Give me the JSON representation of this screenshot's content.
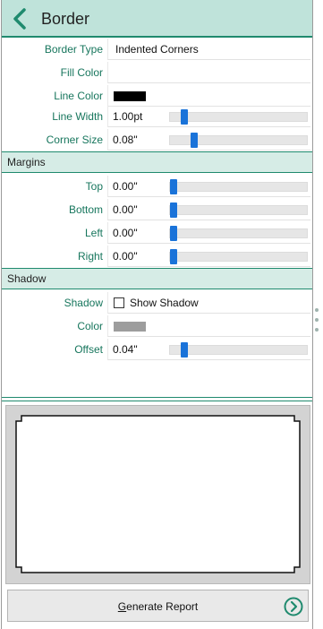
{
  "header": {
    "title": "Border",
    "back_icon": "chevron-left-icon"
  },
  "colors": {
    "accent": "#1f8a6e",
    "header_bg": "#bfe3da",
    "section_bg": "#d6ece6",
    "label": "#17765d",
    "slider_thumb": "#1a73d9"
  },
  "properties": {
    "border_type": {
      "label": "Border Type",
      "value": "Indented Corners"
    },
    "fill_color": {
      "label": "Fill Color",
      "value": ""
    },
    "line_color": {
      "label": "Line Color",
      "color": "#000000"
    },
    "line_width": {
      "label": "Line Width",
      "value": "1.00pt",
      "level": 0.08
    },
    "corner_size": {
      "label": "Corner Size",
      "value": "0.08\"",
      "level": 0.16
    }
  },
  "margins": {
    "title": "Margins",
    "top": {
      "label": "Top",
      "value": "0.00\"",
      "level": 0.0
    },
    "bottom": {
      "label": "Bottom",
      "value": "0.00\"",
      "level": 0.0
    },
    "left": {
      "label": "Left",
      "value": "0.00\"",
      "level": 0.0
    },
    "right": {
      "label": "Right",
      "value": "0.00\"",
      "level": 0.0
    }
  },
  "shadow": {
    "title": "Shadow",
    "shadow": {
      "label": "Shadow",
      "checkbox_label": "Show Shadow",
      "checked": false
    },
    "color": {
      "label": "Color",
      "color": "#9d9d9d"
    },
    "offset": {
      "label": "Offset",
      "value": "0.04\"",
      "level": 0.08
    }
  },
  "footer": {
    "button_prefix": "G",
    "button_rest": "enerate Report",
    "button_icon": "arrow-right-circle-icon"
  }
}
